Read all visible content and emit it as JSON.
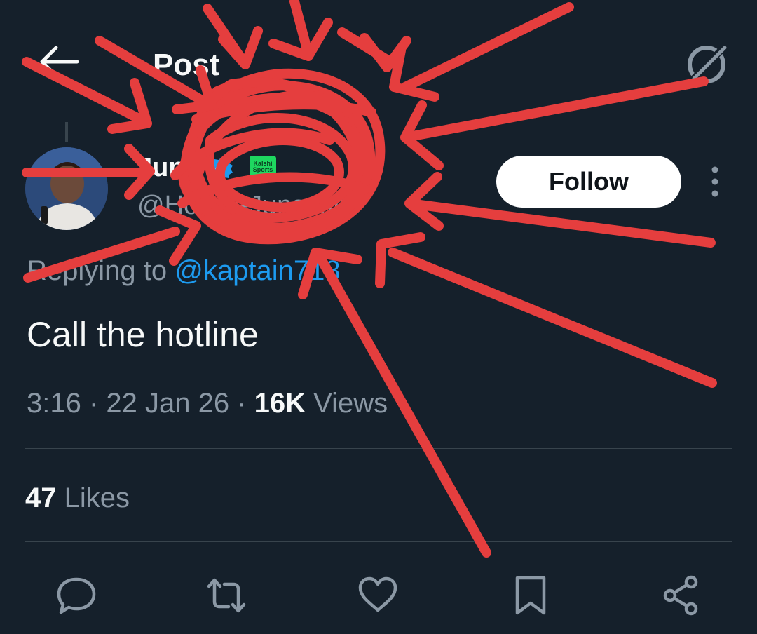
{
  "header": {
    "back_icon": "back-arrow-icon",
    "title": "Post",
    "grok_icon": "grok-icon"
  },
  "author": {
    "display_name": "Jun",
    "handle": "@HoodieJunsson",
    "verified_icon": "verified-badge-icon",
    "affiliate_line1": "Kalshi",
    "affiliate_line2": "Sports",
    "avatar_icon": "user-avatar"
  },
  "follow_label": "Follow",
  "more_icon": "more-vertical-icon",
  "reply": {
    "prefix": "Replying to ",
    "handle": "@kaptain718"
  },
  "tweet": {
    "text": "Call the hotline"
  },
  "meta": {
    "time": "3:16",
    "sep1": " · ",
    "date": "22 Jan 26",
    "sep2": " · ",
    "views_count": "16K",
    "views_label": " Views"
  },
  "likes": {
    "count": "47",
    "label": " Likes"
  },
  "actions": {
    "reply_icon": "reply-icon",
    "retweet_icon": "retweet-icon",
    "like_icon": "heart-icon",
    "bookmark_icon": "bookmark-icon",
    "share_icon": "share-icon"
  },
  "colors": {
    "background": "#15202b",
    "text_primary": "#f7f9f9",
    "text_secondary": "#8b98a5",
    "link": "#1d9bf0",
    "divider": "#38444d",
    "annotation_red": "#e53e3e"
  }
}
